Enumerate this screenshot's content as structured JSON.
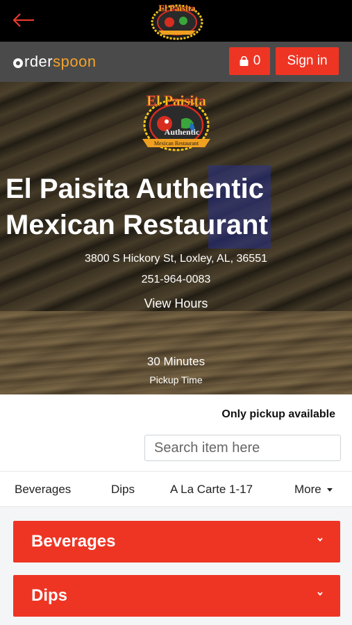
{
  "header": {
    "brand_part1": "rder",
    "brand_part2": "spoon",
    "cart_count": "0",
    "sign_in_label": "Sign in"
  },
  "logo": {
    "line1": "El Paisita",
    "line2": "Authentic",
    "line3": "Mexican Restaurant"
  },
  "restaurant": {
    "name": "El Paisita Authentic Mexican Restaurant",
    "address": "3800 S Hickory St, Loxley, AL, 36551",
    "phone": "251-964-0083",
    "hours_link": "View Hours",
    "pickup_time": "30 Minutes",
    "pickup_time_label": "Pickup Time"
  },
  "ordering": {
    "pickup_note": "Only pickup available",
    "search_placeholder": "Search item here"
  },
  "category_tabs": [
    "Beverages",
    "Dips",
    "A La Carte 1-17",
    "More"
  ],
  "sections": [
    "Beverages",
    "Dips"
  ],
  "colors": {
    "accent": "#ee3524",
    "brand_orange": "#f3a32b",
    "topbar": "#000000",
    "navbar": "#4a4a4a"
  },
  "icons": {
    "back": "left-arrow-icon",
    "cart": "shopping-bag-icon",
    "section_toggle": "chevron-down-icon",
    "more": "caret-down-icon"
  }
}
